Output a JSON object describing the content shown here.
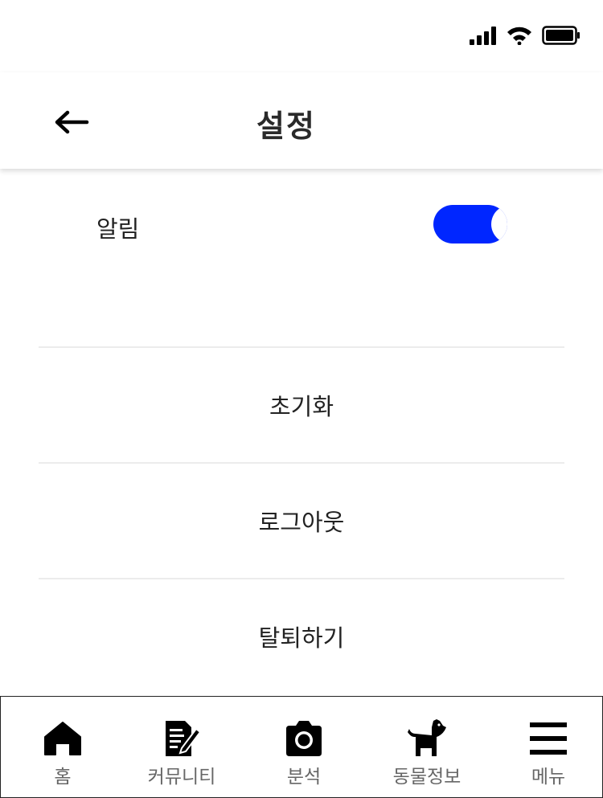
{
  "header": {
    "title": "설정"
  },
  "settings": {
    "notification_label": "알림",
    "notification_enabled": true,
    "accent_color": "#0026ff"
  },
  "actions": [
    {
      "label": "초기화"
    },
    {
      "label": "로그아웃"
    },
    {
      "label": "탈퇴하기"
    }
  ],
  "tabbar": {
    "items": [
      {
        "label": "홈",
        "icon": "home-icon"
      },
      {
        "label": "커뮤니티",
        "icon": "edit-note-icon"
      },
      {
        "label": "분석",
        "icon": "camera-icon"
      },
      {
        "label": "동물정보",
        "icon": "dog-icon"
      },
      {
        "label": "메뉴",
        "icon": "menu-icon"
      }
    ]
  },
  "status_bar": {
    "icons": [
      "signal-icon",
      "wifi-icon",
      "battery-icon"
    ]
  }
}
